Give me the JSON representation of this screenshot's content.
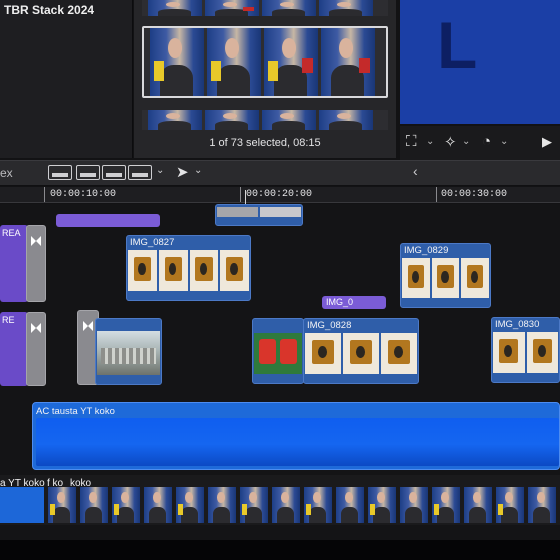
{
  "browser": {
    "library_title": "TBR Stack 2024",
    "selection_status": "1 of 73 selected, 08:15"
  },
  "viewer": {
    "title_letter": "L",
    "background_color": "#1b3fa6"
  },
  "toolbar": {
    "index_label": "ex",
    "arrow_tool_icon": "select-arrow-icon",
    "nav_back_icon": "chevron-left-icon"
  },
  "ruler": {
    "timecodes": [
      "00:00:10:00",
      "00:00:20:00",
      "00:00:30:00"
    ]
  },
  "timeline": {
    "title_clip_left": "REA",
    "title_clip_left_2": "RE",
    "clip_0827": "IMG_0827",
    "clip_0829": "IMG_0829",
    "clip_0828": "IMG_0828",
    "clip_0830": "IMG_0830",
    "title_img_0": "IMG_0",
    "background_clip": "AC tausta YT koko",
    "storyline_label_1": "a YT koko",
    "storyline_label_2": "f ko",
    "storyline_label_3": "koko"
  },
  "colors": {
    "title_purple": "#7b5cd6",
    "clip_blue": "#2f5ea9",
    "background_blue": "#1e6ad9"
  }
}
